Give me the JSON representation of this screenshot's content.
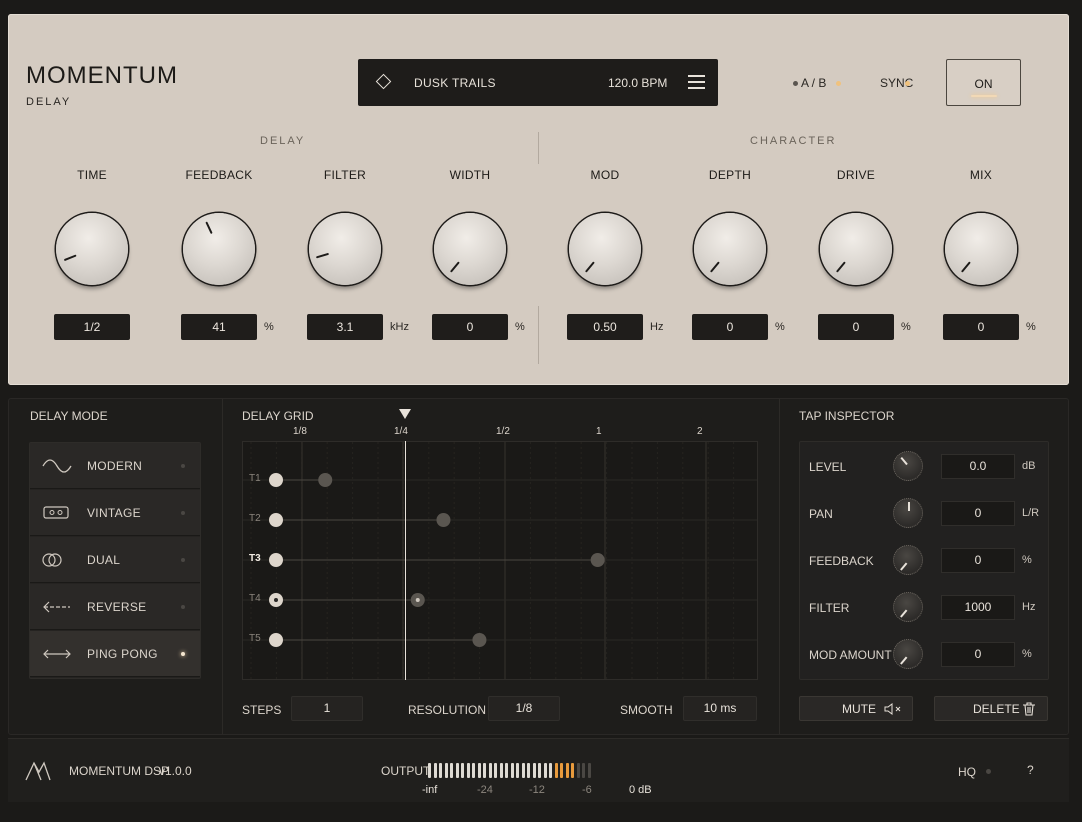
{
  "brand": {
    "title": "MOMENTUM",
    "subtitle": "DELAY"
  },
  "preset": {
    "name": "DUSK TRAILS",
    "bpm": "120.0 BPM"
  },
  "header": {
    "ab_label": "A / B",
    "sync_label": "SYNC",
    "power_label": "ON"
  },
  "colors": {
    "panel": "#d4cbc1",
    "dark": "#1e1d1b",
    "accent_led": "#f4d9b0",
    "meter_hot": "#e89a3c"
  },
  "sections": {
    "delay": "DELAY",
    "character": "CHARACTER"
  },
  "knobs": [
    {
      "label": "TIME",
      "value": "1/2",
      "unit": "",
      "level": 0.1
    },
    {
      "label": "FEEDBACK",
      "value": "41",
      "unit": "%",
      "level": 0.41
    },
    {
      "label": "FILTER",
      "value": "3.1",
      "unit": "kHz",
      "level": 0.12
    },
    {
      "label": "WIDTH",
      "value": "0",
      "unit": "%",
      "level": 0.0
    },
    {
      "label": "MOD",
      "value": "0.50",
      "unit": "Hz",
      "level": 0.0
    },
    {
      "label": "DEPTH",
      "value": "0",
      "unit": "%",
      "level": 0.0
    },
    {
      "label": "DRIVE",
      "value": "0",
      "unit": "%",
      "level": 0.0
    },
    {
      "label": "MIX",
      "value": "0",
      "unit": "%",
      "level": 0.0
    }
  ],
  "delay_mode": {
    "title": "DELAY MODE",
    "items": [
      {
        "label": "MODERN",
        "icon": "sine-wave-icon",
        "active": false
      },
      {
        "label": "VINTAGE",
        "icon": "tape-icon",
        "active": false
      },
      {
        "label": "DUAL",
        "icon": "dual-circles-icon",
        "active": false
      },
      {
        "label": "REVERSE",
        "icon": "reverse-arrow-icon",
        "active": false
      },
      {
        "label": "PING PONG",
        "icon": "ping-pong-arrows-icon",
        "active": true
      }
    ]
  },
  "grid": {
    "title": "DELAY GRID",
    "divisions": [
      "1/8",
      "1/4",
      "1/2",
      "1",
      "2"
    ],
    "taps": [
      {
        "label": "T1",
        "pos": 0.16,
        "active": false
      },
      {
        "label": "T2",
        "pos": 0.39,
        "active": false
      },
      {
        "label": "T3",
        "pos": 0.69,
        "active": true
      },
      {
        "label": "T4",
        "pos": 0.34,
        "active": false
      },
      {
        "label": "T5",
        "pos": 0.46,
        "active": false
      }
    ],
    "steps_label": "STEPS",
    "steps": "1",
    "resolution_label": "RESOLUTION",
    "resolution": "1/8",
    "smooth_label": "SMOOTH",
    "smooth": "10 ms"
  },
  "inspector": {
    "title": "TAP INSPECTOR",
    "rows": [
      {
        "label": "LEVEL",
        "value": "0.0",
        "unit": "dB"
      },
      {
        "label": "PAN",
        "value": "0",
        "unit": "L/R"
      },
      {
        "label": "FEEDBACK",
        "value": "0",
        "unit": "%"
      },
      {
        "label": "FILTER",
        "value": "1000",
        "unit": "Hz"
      },
      {
        "label": "MOD AMOUNT",
        "value": "0",
        "unit": "%"
      }
    ],
    "mute_label": "MUTE",
    "delete_label": "DELETE"
  },
  "footer": {
    "company": "MOMENTUM DSP",
    "version": "v1.0.0",
    "output_label": "OUTPUT",
    "meter_scale": [
      "-inf",
      "-24",
      "-12",
      "-6",
      "0 dB"
    ],
    "hq_label": "HQ",
    "help_label": "?"
  }
}
